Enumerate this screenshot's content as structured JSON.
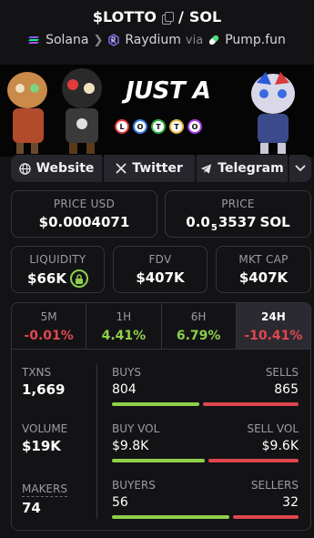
{
  "header": {
    "token": "$LOTTO",
    "separator": "/",
    "quote": "SOL",
    "chain": "Solana",
    "dex": "Raydium",
    "via_label": "via",
    "launchpad": "Pump.fun"
  },
  "banner": {
    "headline": "JUST A",
    "balls": [
      "L",
      "O",
      "T",
      "T",
      "O"
    ],
    "ball_colors": [
      "#e23a3a",
      "#3a7ee2",
      "#2fb34a",
      "#e2b43a",
      "#a43ae2"
    ]
  },
  "links": {
    "website": "Website",
    "twitter": "Twitter",
    "telegram": "Telegram"
  },
  "price": {
    "usd_label": "PRICE USD",
    "usd_value": "$0.0004071",
    "sol_label": "PRICE",
    "sol_prefix": "0.0",
    "sol_zeros": "5",
    "sol_digits": "3537",
    "sol_unit": "SOL"
  },
  "metrics": {
    "liquidity_label": "LIQUIDITY",
    "liquidity_value": "$66K",
    "fdv_label": "FDV",
    "fdv_value": "$407K",
    "mcap_label": "MKT CAP",
    "mcap_value": "$407K"
  },
  "timeframes": [
    {
      "label": "5M",
      "value": "-0.01%",
      "color": "#e0474f"
    },
    {
      "label": "1H",
      "value": "4.41%",
      "color": "#8fcf4a"
    },
    {
      "label": "6H",
      "value": "6.79%",
      "color": "#8fcf4a"
    },
    {
      "label": "24H",
      "value": "-10.41%",
      "color": "#e0474f"
    }
  ],
  "active_timeframe": "24H",
  "stats": {
    "txns_label": "TXNS",
    "txns_value": "1,669",
    "volume_label": "VOLUME",
    "volume_value": "$19K",
    "makers_label": "MAKERS",
    "makers_value": "74",
    "buys_label": "BUYS",
    "buys_value": "804",
    "sells_label": "SELLS",
    "sells_value": "865",
    "buys_fraction": 0.48,
    "buy_vol_label": "BUY VOL",
    "buy_vol_value": "$9.8K",
    "sell_vol_label": "SELL VOL",
    "sell_vol_value": "$9.6K",
    "buy_vol_fraction": 0.505,
    "buyers_label": "BUYERS",
    "buyers_value": "56",
    "sellers_label": "SELLERS",
    "sellers_value": "32",
    "buyers_fraction": 0.64
  },
  "colors": {
    "up": "#8fcf4a",
    "down": "#e0474f",
    "bg": "#131316",
    "border": "#34343b"
  }
}
